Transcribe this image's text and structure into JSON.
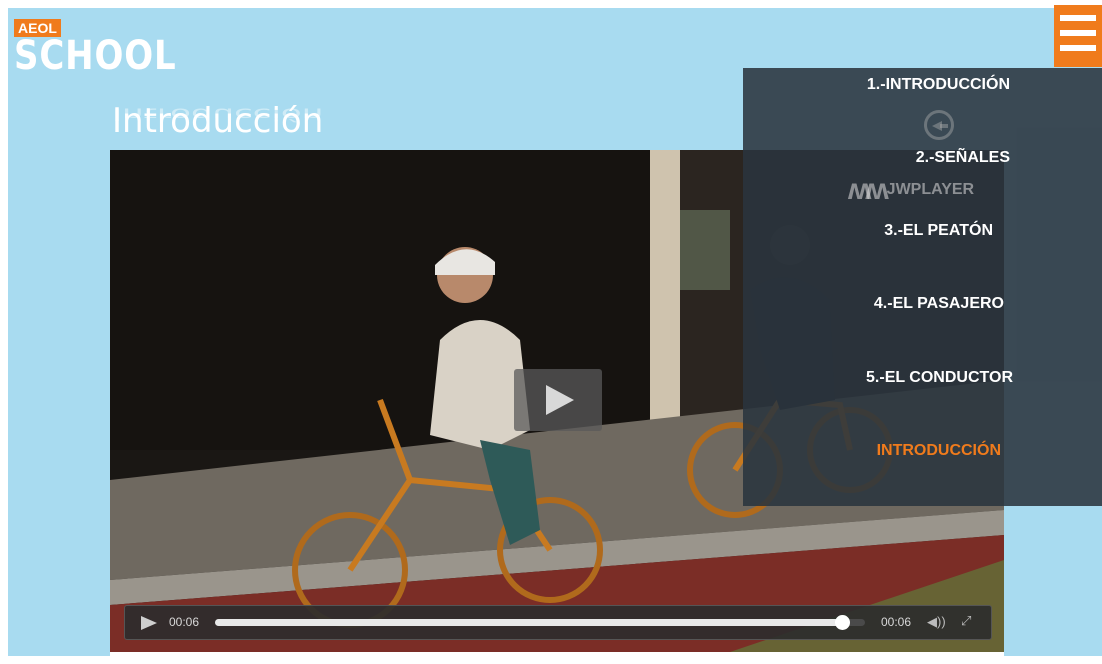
{
  "brand": {
    "badge": "AEOL",
    "name": "SCHOOL"
  },
  "page": {
    "title": "Introducción"
  },
  "nav": {
    "items": [
      {
        "label": "1.-INTRODUCCIÓN"
      },
      {
        "label": "2.-SEÑALES"
      },
      {
        "label": "3.-EL PEATÓN"
      },
      {
        "label": "4.-EL PASAJERO"
      },
      {
        "label": "5.-EL CONDUCTOR"
      },
      {
        "label": "INTRODUCCIÓN",
        "active": true
      }
    ],
    "back_icon": "back-arrow-icon",
    "menu_icon": "hamburger-icon"
  },
  "player": {
    "watermark": "JWPLAYER",
    "elapsed": "00:06",
    "duration": "00:06",
    "progress": 0.96,
    "icons": [
      "play-icon",
      "volume-icon",
      "fullscreen-icon"
    ]
  },
  "colors": {
    "accent": "#f07b1c",
    "background": "#a8dbf0",
    "menu": "#2a343d"
  }
}
